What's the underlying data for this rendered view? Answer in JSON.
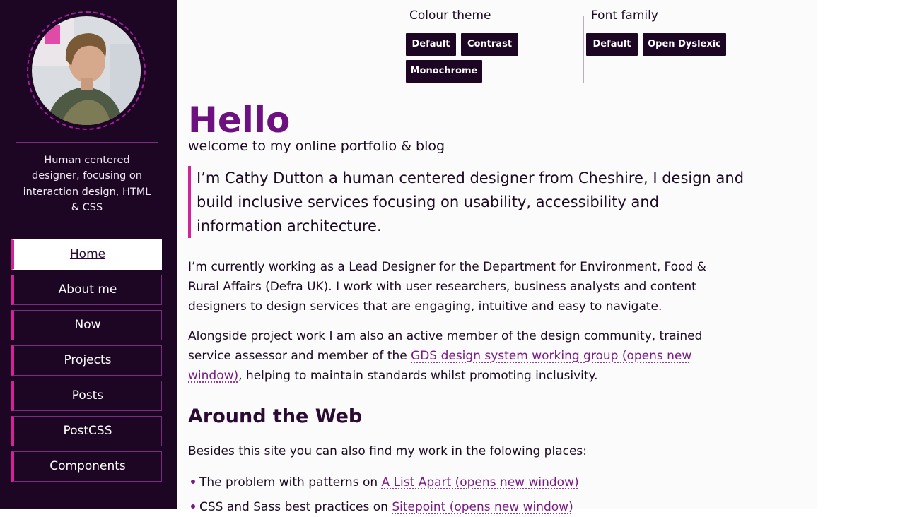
{
  "sidebar": {
    "tagline": "Human centered designer, focusing on interaction design, HTML & CSS",
    "nav": [
      "Home",
      "About me",
      "Now",
      "Projects",
      "Posts",
      "PostCSS",
      "Components"
    ],
    "active": "Home"
  },
  "theme": {
    "colour_legend": "Colour theme",
    "colour_buttons": [
      "Default",
      "Contrast",
      "Monochrome"
    ],
    "font_legend": "Font family",
    "font_buttons": [
      "Default",
      "Open Dyslexic"
    ]
  },
  "main": {
    "title": "Hello",
    "subtitle": "welcome to my online portfolio & blog",
    "lead": "I’m Cathy Dutton a human centered designer from Cheshire, I design and build inclusive services focusing on usability, accessibility and information architecture.",
    "para1": "I’m currently working as a Lead Designer for the Department for Environment, Food & Rural Affairs (Defra UK). I work with user researchers, business analysts and content designers to design services that are engaging, intuitive and easy to navigate.",
    "para2_before": "Alongside project work I am also an active member of the design community, trained service assessor and member of the ",
    "para2_link": "GDS design system working group (opens new window)",
    "para2_after": ", helping to maintain standards whilst promoting inclusivity.",
    "web_heading": "Around the Web",
    "web_intro": "Besides this site you can also find my work in the folowing places:",
    "web_items": [
      {
        "text": "The problem with patterns on ",
        "link": "A List Apart (opens new window)"
      },
      {
        "text": "CSS and Sass best practices on ",
        "link": "Sitepoint (opens new window)"
      }
    ]
  },
  "colors": {
    "accent": "#d4239a",
    "sidebar_bg": "#1d0623",
    "heading": "#6d1180"
  }
}
